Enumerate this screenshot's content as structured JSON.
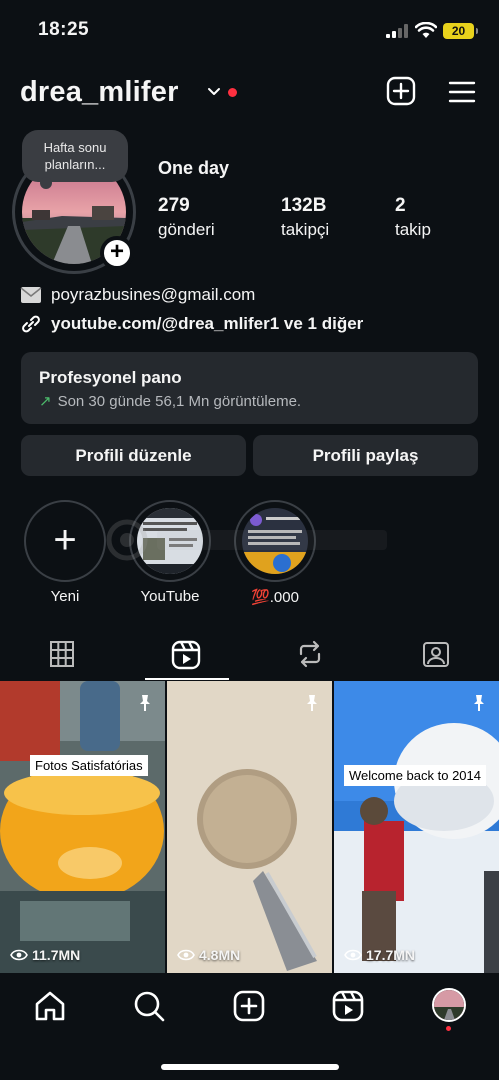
{
  "status_bar": {
    "time": "18:25",
    "battery": "20"
  },
  "profile": {
    "username": "drea_mlifer",
    "note": "Hafta sonu planların...",
    "display_name": "One day",
    "stats": [
      {
        "value": "279",
        "label": "gönderi"
      },
      {
        "value": "132B",
        "label": "takipçi"
      },
      {
        "value": "2",
        "label": "takip"
      }
    ],
    "email": "poyrazbusines@gmail.com",
    "link": "youtube.com/@drea_mlifer1 ve 1 diğer"
  },
  "pro_panel": {
    "title": "Profesyonel pano",
    "subtitle": "Son 30 günde 56,1 Mn görüntüleme."
  },
  "buttons": {
    "edit": "Profili düzenle",
    "share": "Profili paylaş"
  },
  "highlights": [
    {
      "label": "Yeni"
    },
    {
      "label": "YouTube"
    },
    {
      "label": "💯.000"
    }
  ],
  "tabs": [
    "grid-tab",
    "reels-tab",
    "reposts-tab",
    "tagged-tab"
  ],
  "reels": [
    {
      "caption": "Fotos Satisfatórias",
      "views": "11.7MN",
      "pinned": true
    },
    {
      "caption": "",
      "views": "4.8MN",
      "pinned": true
    },
    {
      "caption": "Welcome back to 2014",
      "views": "17.7MN",
      "pinned": true
    }
  ],
  "colors": {
    "background": "#0c1014",
    "panel": "#25292e",
    "notification": "#ff3040",
    "trend": "#4cbb6c"
  }
}
